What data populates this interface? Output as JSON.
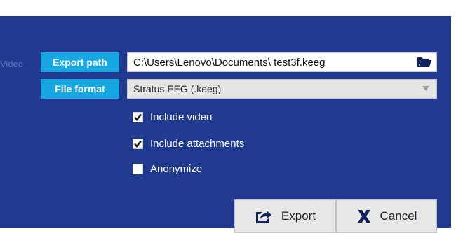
{
  "background": {
    "partial_label": "Video"
  },
  "form": {
    "export_path": {
      "label": "Export path",
      "value": "C:\\Users\\Lenovo\\Documents\\ test3f.keeg",
      "browse_icon": "folder-open-icon"
    },
    "file_format": {
      "label": "File format",
      "selected": "Stratus EEG (.keeg)"
    },
    "options": [
      {
        "label": "Include video",
        "checked": true
      },
      {
        "label": "Include attachments",
        "checked": true
      },
      {
        "label": "Anonymize",
        "checked": false
      }
    ]
  },
  "buttons": {
    "export": {
      "label": "Export",
      "icon": "share-export-icon"
    },
    "cancel": {
      "label": "Cancel",
      "icon": "x-icon"
    }
  },
  "colors": {
    "dialog_bg": "#1f3a8f",
    "label_badge": "#17a8e3",
    "button_bg": "#e7e7e7",
    "icon_dark": "#13235e"
  }
}
